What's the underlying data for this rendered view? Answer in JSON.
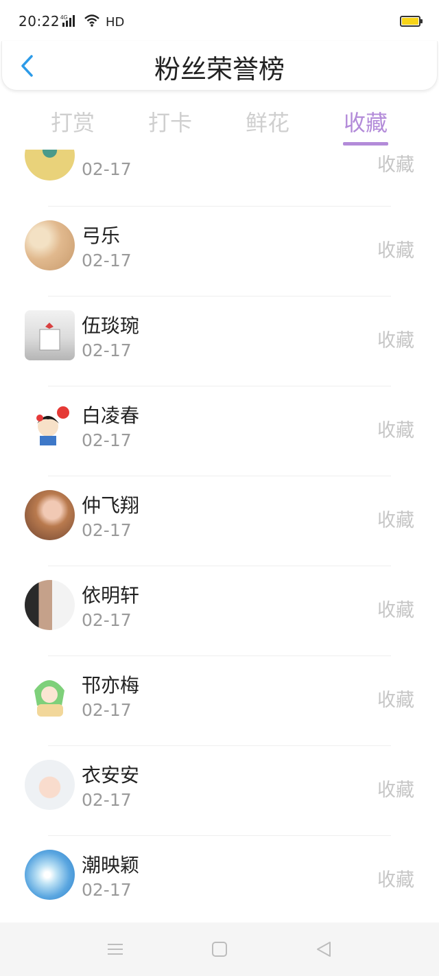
{
  "status_bar": {
    "time": "20:22",
    "network": "4G",
    "hd": "HD"
  },
  "header": {
    "title": "粉丝荣誉榜"
  },
  "tabs": [
    {
      "label": "打赏",
      "active": false
    },
    {
      "label": "打卡",
      "active": false
    },
    {
      "label": "鲜花",
      "active": false
    },
    {
      "label": "收藏",
      "active": true
    }
  ],
  "list": {
    "items": [
      {
        "name": "",
        "date": "02-17",
        "action": "收藏"
      },
      {
        "name": "弓乐",
        "date": "02-17",
        "action": "收藏"
      },
      {
        "name": "伍琰琬",
        "date": "02-17",
        "action": "收藏"
      },
      {
        "name": "白凌春",
        "date": "02-17",
        "action": "收藏"
      },
      {
        "name": "仲飞翔",
        "date": "02-17",
        "action": "收藏"
      },
      {
        "name": "依明轩",
        "date": "02-17",
        "action": "收藏"
      },
      {
        "name": "邗亦梅",
        "date": "02-17",
        "action": "收藏"
      },
      {
        "name": "衣安安",
        "date": "02-17",
        "action": "收藏"
      },
      {
        "name": "潮映颖",
        "date": "02-17",
        "action": "收藏"
      }
    ]
  },
  "colors": {
    "accent": "#b38bd9",
    "back_arrow": "#2d9be8",
    "battery": "#f7d418"
  }
}
